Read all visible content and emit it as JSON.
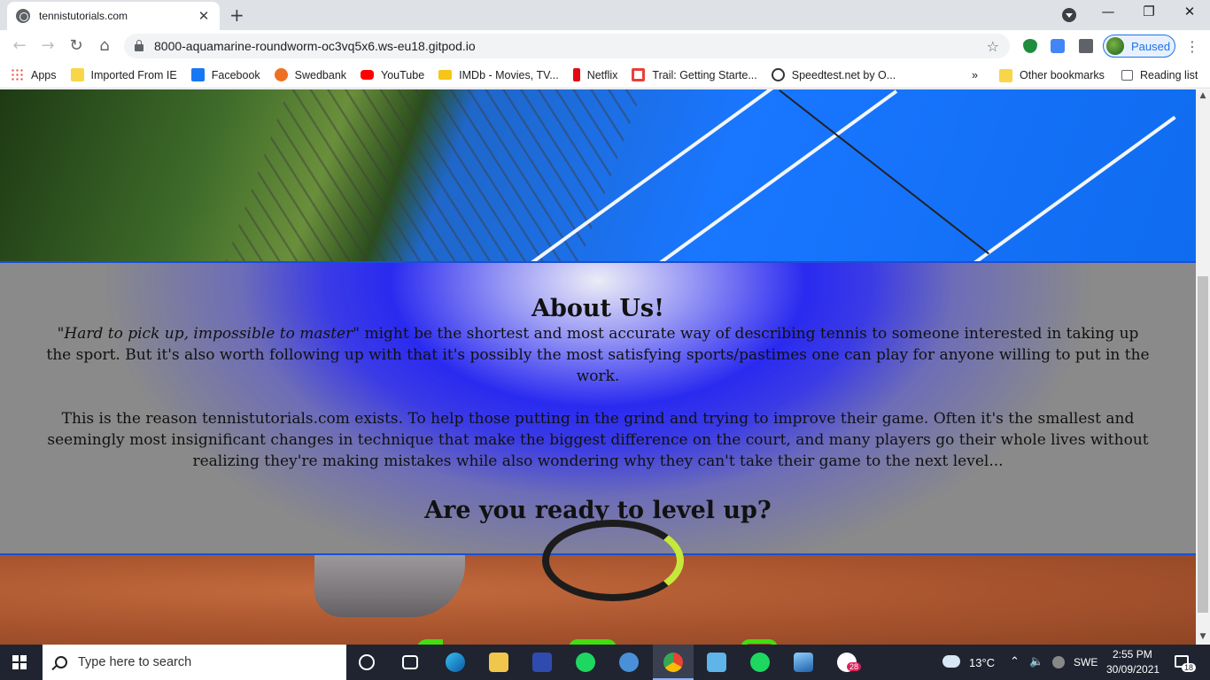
{
  "browser": {
    "tab": {
      "title": "tennistutorials.com"
    },
    "url": "8000-aquamarine-roundworm-oc3vq5x6.ws-eu18.gitpod.io",
    "profile_label": "Paused",
    "window_controls": {
      "minimize": "—",
      "restore": "❐",
      "close": "✕"
    },
    "bookmarks": [
      {
        "label": "Apps",
        "color": "#ea4335"
      },
      {
        "label": "Imported From IE",
        "color": "#f9d649"
      },
      {
        "label": "Facebook",
        "color": "#1877f2"
      },
      {
        "label": "Swedbank",
        "color": "#ee7023"
      },
      {
        "label": "YouTube",
        "color": "#ff0000"
      },
      {
        "label": "IMDb - Movies, TV...",
        "color": "#f5c518"
      },
      {
        "label": "Netflix",
        "color": "#e50914"
      },
      {
        "label": "Trail: Getting Starte...",
        "color": "#e8403a"
      },
      {
        "label": "Speedtest.net by O...",
        "color": "#333333"
      }
    ],
    "bookmarks_overflow": "»",
    "other_bookmarks": "Other bookmarks",
    "reading_list": "Reading list"
  },
  "page": {
    "about": {
      "title": "About Us!",
      "quote": "\"Hard to pick up, impossible to master\"",
      "p1_rest": " might be the shortest and most accurate way of describing tennis to someone interested in taking up the sport. But it's also worth following up with that it's possibly the most satisfying sports/pastimes one can play for anyone willing to put in the work.",
      "p2": "This is the reason tennistutorials.com exists. To help those putting in the grind and trying to improve their game. Often it's the smallest and seemingly most insignificant changes in technique that make the biggest difference on the court, and many players go their whole lives without realizing they're making mistakes while also wondering why they can't take their game to the next level...",
      "cta": "Are you ready to level up?"
    },
    "social_links": [
      "facebook-icon",
      "youtube-icon",
      "instagram-icon"
    ],
    "accent_color": "#44dd11"
  },
  "taskbar": {
    "search_placeholder": "Type here to search",
    "weather": "13°C",
    "language": "SWE",
    "time": "2:55 PM",
    "date": "30/09/2021",
    "notifications": "18",
    "slack_badge": "28"
  }
}
